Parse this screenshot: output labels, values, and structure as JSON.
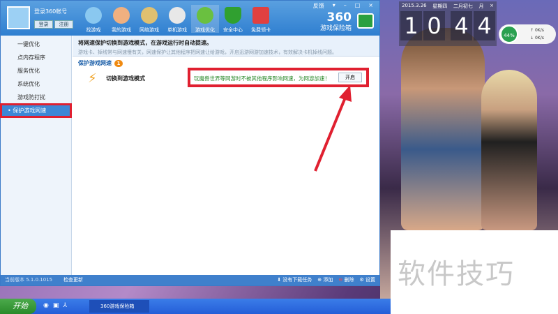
{
  "window": {
    "login_title": "登录360帐号",
    "login_btn": "登录",
    "register_btn": "注册",
    "feedback": "反馈",
    "nav": [
      "找游戏",
      "我的游戏",
      "网络游戏",
      "单机游戏",
      "游戏优化",
      "安全中心",
      "免费领卡"
    ],
    "brand_line1": "360",
    "brand_line2": "游戏保险箱"
  },
  "sidebar": {
    "items": [
      "一键优化",
      "点内存程序",
      "服务优化",
      "系统优化",
      "游戏防打扰",
      "保护游戏网速"
    ]
  },
  "main": {
    "tip_title": "将网速保护切换到游戏模式，在游戏运行时自动提速。",
    "tip_desc": "游戏卡、掉线常与网速慢有关，网速保护让其他程序把网速让给游戏，开启迅游网游加速技术，有效解决卡机掉线问题。",
    "section_title": "保护游戏网速",
    "section_badge": "1",
    "row_label": "切换到游戏模式",
    "row_desc": "玩魔兽世界等网游时不被其他程序影响网速，为网游加速！",
    "open_btn": "开启"
  },
  "status": {
    "version": "当前版本 5.1.0.1015",
    "check_update": "检查更新",
    "downloads": "没有下载任务",
    "add": "添加",
    "delete": "删除",
    "settings": "设置"
  },
  "clock": {
    "date": "2015.3.26",
    "weekday": "星期四",
    "lunar": "二月初七",
    "digits": [
      "1",
      "0",
      "4",
      "4"
    ],
    "month_btn": "月",
    "close": "×"
  },
  "net": {
    "percent": "44%",
    "up": "0K/s",
    "down": "0K/s"
  },
  "watermark": "软件技巧",
  "taskbar": {
    "start": "开始",
    "task": "360游戏保险箱"
  },
  "colors": {
    "accent": "#3d87d6",
    "highlight": "#e02030"
  }
}
